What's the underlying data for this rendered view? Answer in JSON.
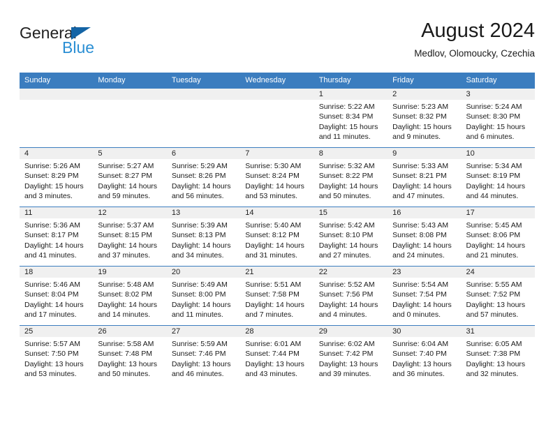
{
  "brand": {
    "name_top": "General",
    "name_bottom": "Blue",
    "triangle_color": "#1464a5",
    "blue_color": "#2b8fd4"
  },
  "header": {
    "title": "August 2024",
    "subtitle": "Medlov, Olomoucky, Czechia"
  },
  "theme": {
    "header_bg": "#3b7dbf",
    "daynum_bg": "#f0f0f0",
    "row_border": "#3b7dbf"
  },
  "weekdays": [
    "Sunday",
    "Monday",
    "Tuesday",
    "Wednesday",
    "Thursday",
    "Friday",
    "Saturday"
  ],
  "labels": {
    "sunrise": "Sunrise:",
    "sunset": "Sunset:",
    "daylight": "Daylight:"
  },
  "weeks": [
    [
      {
        "day": "",
        "empty": true
      },
      {
        "day": "",
        "empty": true
      },
      {
        "day": "",
        "empty": true
      },
      {
        "day": "",
        "empty": true
      },
      {
        "day": "1",
        "sunrise": "Sunrise: 5:22 AM",
        "sunset": "Sunset: 8:34 PM",
        "daylight": "Daylight: 15 hours and 11 minutes."
      },
      {
        "day": "2",
        "sunrise": "Sunrise: 5:23 AM",
        "sunset": "Sunset: 8:32 PM",
        "daylight": "Daylight: 15 hours and 9 minutes."
      },
      {
        "day": "3",
        "sunrise": "Sunrise: 5:24 AM",
        "sunset": "Sunset: 8:30 PM",
        "daylight": "Daylight: 15 hours and 6 minutes."
      }
    ],
    [
      {
        "day": "4",
        "sunrise": "Sunrise: 5:26 AM",
        "sunset": "Sunset: 8:29 PM",
        "daylight": "Daylight: 15 hours and 3 minutes."
      },
      {
        "day": "5",
        "sunrise": "Sunrise: 5:27 AM",
        "sunset": "Sunset: 8:27 PM",
        "daylight": "Daylight: 14 hours and 59 minutes."
      },
      {
        "day": "6",
        "sunrise": "Sunrise: 5:29 AM",
        "sunset": "Sunset: 8:26 PM",
        "daylight": "Daylight: 14 hours and 56 minutes."
      },
      {
        "day": "7",
        "sunrise": "Sunrise: 5:30 AM",
        "sunset": "Sunset: 8:24 PM",
        "daylight": "Daylight: 14 hours and 53 minutes."
      },
      {
        "day": "8",
        "sunrise": "Sunrise: 5:32 AM",
        "sunset": "Sunset: 8:22 PM",
        "daylight": "Daylight: 14 hours and 50 minutes."
      },
      {
        "day": "9",
        "sunrise": "Sunrise: 5:33 AM",
        "sunset": "Sunset: 8:21 PM",
        "daylight": "Daylight: 14 hours and 47 minutes."
      },
      {
        "day": "10",
        "sunrise": "Sunrise: 5:34 AM",
        "sunset": "Sunset: 8:19 PM",
        "daylight": "Daylight: 14 hours and 44 minutes."
      }
    ],
    [
      {
        "day": "11",
        "sunrise": "Sunrise: 5:36 AM",
        "sunset": "Sunset: 8:17 PM",
        "daylight": "Daylight: 14 hours and 41 minutes."
      },
      {
        "day": "12",
        "sunrise": "Sunrise: 5:37 AM",
        "sunset": "Sunset: 8:15 PM",
        "daylight": "Daylight: 14 hours and 37 minutes."
      },
      {
        "day": "13",
        "sunrise": "Sunrise: 5:39 AM",
        "sunset": "Sunset: 8:13 PM",
        "daylight": "Daylight: 14 hours and 34 minutes."
      },
      {
        "day": "14",
        "sunrise": "Sunrise: 5:40 AM",
        "sunset": "Sunset: 8:12 PM",
        "daylight": "Daylight: 14 hours and 31 minutes."
      },
      {
        "day": "15",
        "sunrise": "Sunrise: 5:42 AM",
        "sunset": "Sunset: 8:10 PM",
        "daylight": "Daylight: 14 hours and 27 minutes."
      },
      {
        "day": "16",
        "sunrise": "Sunrise: 5:43 AM",
        "sunset": "Sunset: 8:08 PM",
        "daylight": "Daylight: 14 hours and 24 minutes."
      },
      {
        "day": "17",
        "sunrise": "Sunrise: 5:45 AM",
        "sunset": "Sunset: 8:06 PM",
        "daylight": "Daylight: 14 hours and 21 minutes."
      }
    ],
    [
      {
        "day": "18",
        "sunrise": "Sunrise: 5:46 AM",
        "sunset": "Sunset: 8:04 PM",
        "daylight": "Daylight: 14 hours and 17 minutes."
      },
      {
        "day": "19",
        "sunrise": "Sunrise: 5:48 AM",
        "sunset": "Sunset: 8:02 PM",
        "daylight": "Daylight: 14 hours and 14 minutes."
      },
      {
        "day": "20",
        "sunrise": "Sunrise: 5:49 AM",
        "sunset": "Sunset: 8:00 PM",
        "daylight": "Daylight: 14 hours and 11 minutes."
      },
      {
        "day": "21",
        "sunrise": "Sunrise: 5:51 AM",
        "sunset": "Sunset: 7:58 PM",
        "daylight": "Daylight: 14 hours and 7 minutes."
      },
      {
        "day": "22",
        "sunrise": "Sunrise: 5:52 AM",
        "sunset": "Sunset: 7:56 PM",
        "daylight": "Daylight: 14 hours and 4 minutes."
      },
      {
        "day": "23",
        "sunrise": "Sunrise: 5:54 AM",
        "sunset": "Sunset: 7:54 PM",
        "daylight": "Daylight: 14 hours and 0 minutes."
      },
      {
        "day": "24",
        "sunrise": "Sunrise: 5:55 AM",
        "sunset": "Sunset: 7:52 PM",
        "daylight": "Daylight: 13 hours and 57 minutes."
      }
    ],
    [
      {
        "day": "25",
        "sunrise": "Sunrise: 5:57 AM",
        "sunset": "Sunset: 7:50 PM",
        "daylight": "Daylight: 13 hours and 53 minutes."
      },
      {
        "day": "26",
        "sunrise": "Sunrise: 5:58 AM",
        "sunset": "Sunset: 7:48 PM",
        "daylight": "Daylight: 13 hours and 50 minutes."
      },
      {
        "day": "27",
        "sunrise": "Sunrise: 5:59 AM",
        "sunset": "Sunset: 7:46 PM",
        "daylight": "Daylight: 13 hours and 46 minutes."
      },
      {
        "day": "28",
        "sunrise": "Sunrise: 6:01 AM",
        "sunset": "Sunset: 7:44 PM",
        "daylight": "Daylight: 13 hours and 43 minutes."
      },
      {
        "day": "29",
        "sunrise": "Sunrise: 6:02 AM",
        "sunset": "Sunset: 7:42 PM",
        "daylight": "Daylight: 13 hours and 39 minutes."
      },
      {
        "day": "30",
        "sunrise": "Sunrise: 6:04 AM",
        "sunset": "Sunset: 7:40 PM",
        "daylight": "Daylight: 13 hours and 36 minutes."
      },
      {
        "day": "31",
        "sunrise": "Sunrise: 6:05 AM",
        "sunset": "Sunset: 7:38 PM",
        "daylight": "Daylight: 13 hours and 32 minutes."
      }
    ]
  ]
}
